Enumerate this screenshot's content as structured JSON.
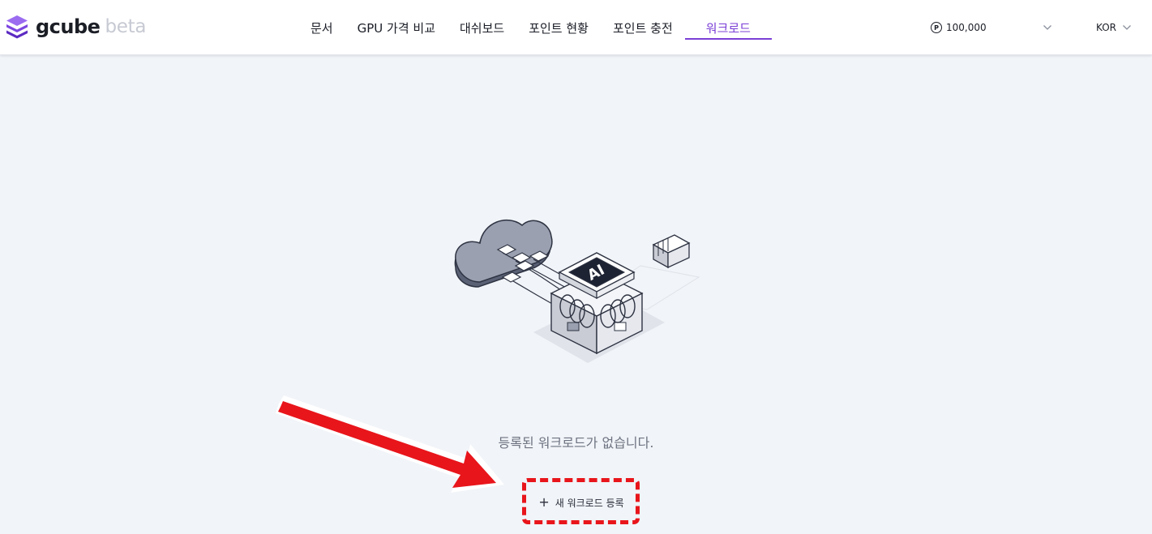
{
  "header": {
    "logo": {
      "wordmark": "gcube",
      "beta": "beta",
      "icon": "stacked-cube-logo"
    },
    "nav": [
      {
        "label": "문서"
      },
      {
        "label": "GPU 가격 비교"
      },
      {
        "label": "대쉬보드"
      },
      {
        "label": "포인트 현황"
      },
      {
        "label": "포인트 충전"
      },
      {
        "label": "워크로드",
        "active": true
      }
    ],
    "points": {
      "icon_letter": "P",
      "amount": "100,000"
    },
    "language": "KOR"
  },
  "main": {
    "empty_message": "등록된 워크로드가 없습니다.",
    "new_button": {
      "icon": "+",
      "label": "새 워크로드 등록"
    },
    "illustration_chip_label": "AI"
  },
  "colors": {
    "accent": "#7b3fd6",
    "background": "#f1f4f8",
    "annotation_red": "#e8151b"
  }
}
